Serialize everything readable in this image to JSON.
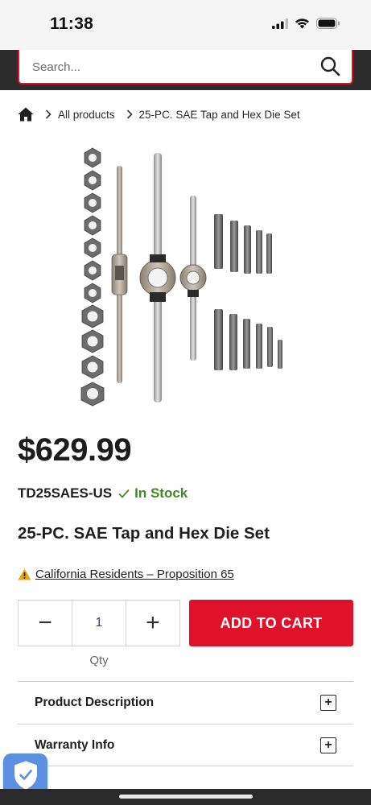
{
  "status_bar": {
    "time": "11:38"
  },
  "search": {
    "placeholder": "Search..."
  },
  "breadcrumb": {
    "items": [
      {
        "label": "All products"
      },
      {
        "label": "25-PC. SAE Tap and Hex Die Set"
      }
    ]
  },
  "product": {
    "price": "$629.99",
    "sku": "TD25SAES-US",
    "stock_status": "In Stock",
    "title": "25-PC. SAE Tap and Hex Die Set",
    "prop65_link": "California Residents – Proposition 65"
  },
  "quantity": {
    "decrement_symbol": "−",
    "value": "1",
    "increment_symbol": "+",
    "label": "Qty"
  },
  "cart": {
    "add_label": "ADD TO CART"
  },
  "accordion": [
    {
      "title": "Product Description",
      "toggle": "+"
    },
    {
      "title": "Warranty Info",
      "toggle": "+"
    }
  ],
  "colors": {
    "brand_red": "#e0112b",
    "header_dark": "#2c2c2c",
    "in_stock_green": "#3d8b22",
    "badge_blue": "#5b8fe0",
    "warning_orange": "#e8a317"
  },
  "icons": [
    "home-icon",
    "search-icon",
    "chevron-right-icon",
    "check-icon",
    "warning-icon",
    "shield-check-icon",
    "signal-icon",
    "wifi-icon",
    "battery-icon"
  ]
}
